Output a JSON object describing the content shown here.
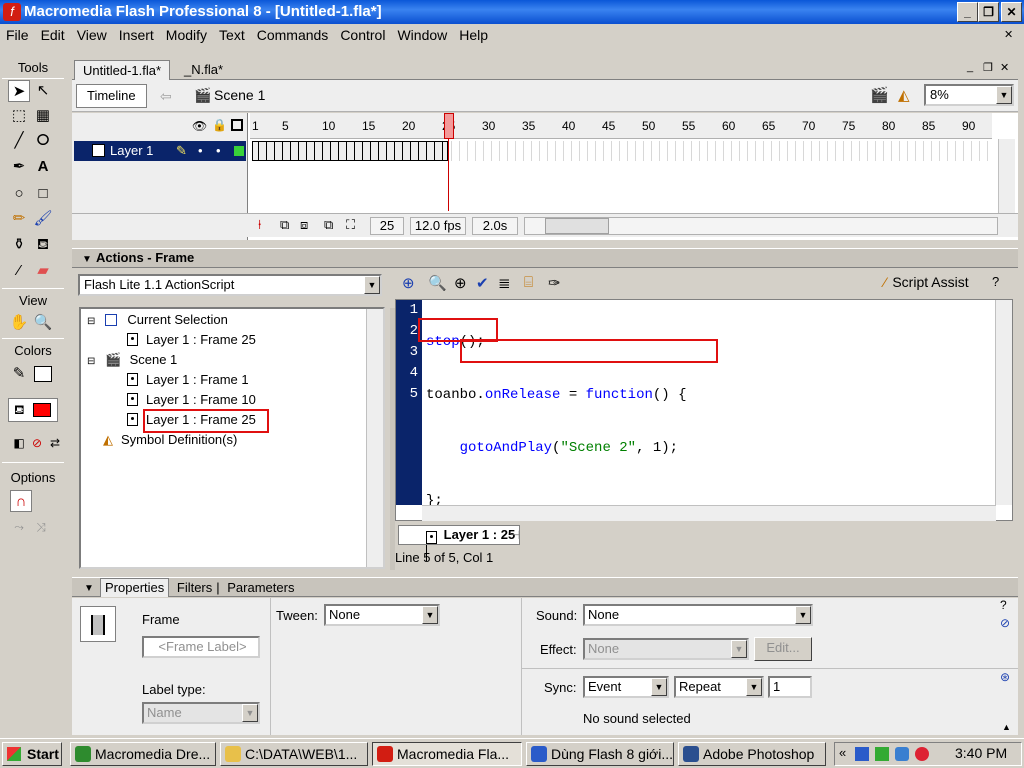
{
  "window": {
    "title": "Macromedia Flash Professional 8 - [Untitled-1.fla*]",
    "logo_glyph": "f"
  },
  "menu": [
    "File",
    "Edit",
    "View",
    "Insert",
    "Modify",
    "Text",
    "Commands",
    "Control",
    "Window",
    "Help"
  ],
  "tools": {
    "title": "Tools",
    "view_label": "View",
    "colors_label": "Colors",
    "options_label": "Options",
    "stroke_color": "#000000",
    "fill_color": "#ff0000"
  },
  "doc_tabs": [
    "Untitled-1.fla*",
    "_N.fla*"
  ],
  "timeline": {
    "tab_label": "Timeline",
    "scene_label": "Scene 1",
    "zoom": "8%",
    "ruler_ticks": [
      "1",
      "5",
      "10",
      "15",
      "20",
      "25",
      "30",
      "35",
      "40",
      "45",
      "50",
      "55",
      "60",
      "65",
      "70",
      "75",
      "80",
      "85",
      "90"
    ],
    "layer_name": "Layer 1",
    "current_frame": "25",
    "fps": "12.0 fps",
    "time": "2.0s"
  },
  "actions_panel": {
    "title": "Actions - Frame",
    "language": "Flash Lite 1.1 ActionScript",
    "script_assist": "Script Assist",
    "tree": [
      {
        "label": "Current Selection",
        "level": 0,
        "icon": "selection-icon"
      },
      {
        "label": "Layer 1 : Frame 25",
        "level": 1,
        "icon": "frame-icon"
      },
      {
        "label": "Scene 1",
        "level": 0,
        "icon": "scene-icon"
      },
      {
        "label": "Layer 1 : Frame 1",
        "level": 1,
        "icon": "frame-icon"
      },
      {
        "label": "Layer 1 : Frame 10",
        "level": 1,
        "icon": "frame-icon"
      },
      {
        "label": "Layer 1 : Frame 25",
        "level": 1,
        "icon": "frame-icon"
      },
      {
        "label": "Symbol Definition(s)",
        "level": 0,
        "icon": "symbol-icon"
      }
    ],
    "line_numbers": [
      "1",
      "2",
      "3",
      "4",
      "5"
    ],
    "code": {
      "l1_kw": "stop",
      "l1_rest": "();",
      "l2_obj": "toanbo.",
      "l2_prop": "onRelease",
      "l2_eq": " = ",
      "l2_kw": "function",
      "l2_rest": "() {",
      "l3_indent": "    ",
      "l3_kw": "gotoAndPlay",
      "l3_open": "(",
      "l3_str": "\"Scene 2\"",
      "l3_rest": ", 1);",
      "l4": "};"
    },
    "frame_tab": "Layer 1 : 25",
    "status": "Line 5 of 5, Col 1"
  },
  "properties": {
    "tabs": [
      "Properties",
      "Filters",
      "Parameters"
    ],
    "frame_label": "Frame",
    "frame_label_placeholder": "<Frame Label>",
    "label_type_label": "Label type:",
    "label_type_value": "Name",
    "tween_label": "Tween:",
    "tween_value": "None",
    "sound_label": "Sound:",
    "sound_value": "None",
    "effect_label": "Effect:",
    "effect_value": "None",
    "edit_button": "Edit...",
    "sync_label": "Sync:",
    "sync_value": "Event",
    "repeat_value": "Repeat",
    "repeat_count": "1",
    "sound_status": "No sound selected"
  },
  "taskbar": {
    "start": "Start",
    "tasks": [
      {
        "label": "Macromedia Dre...",
        "color": "#2e8b2e"
      },
      {
        "label": "C:\\DATA\\WEB\\1...",
        "color": "#e8c04a"
      },
      {
        "label": "Macromedia Fla...",
        "color": "#d21d12"
      },
      {
        "label": "Dùng Flash 8 giới...",
        "color": "#2a5bc9"
      },
      {
        "label": "Adobe Photoshop",
        "color": "#2b4f8f"
      }
    ],
    "clock": "3:40 PM"
  }
}
